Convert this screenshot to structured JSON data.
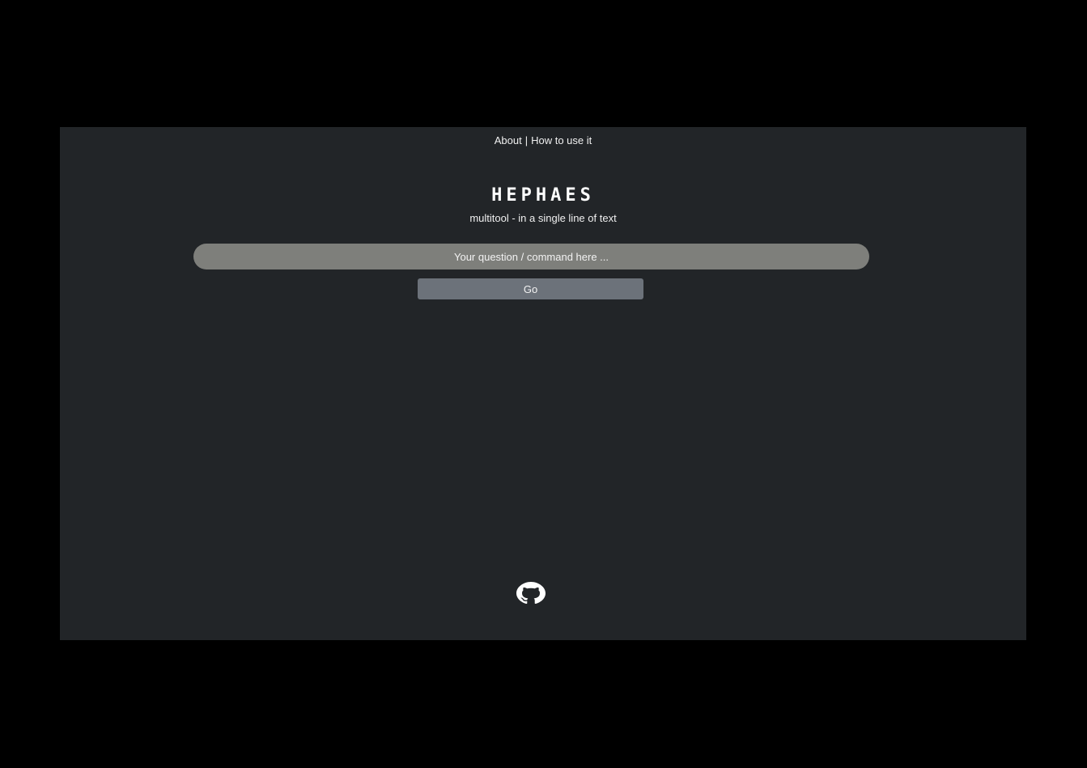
{
  "nav": {
    "about": "About",
    "separator": "|",
    "how_to": "How to use it"
  },
  "header": {
    "logo": "HEPHAES",
    "tagline": "multitool - in a single line of text"
  },
  "search": {
    "placeholder": "Your question / command here ...",
    "value": ""
  },
  "actions": {
    "go_label": "Go"
  },
  "footer": {
    "icon": "github-icon"
  }
}
